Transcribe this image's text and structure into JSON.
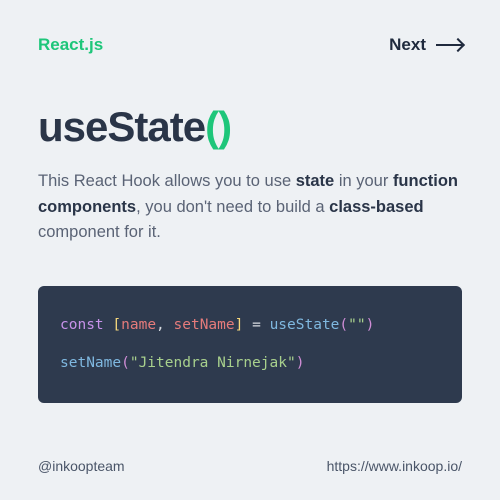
{
  "header": {
    "brand": "React.js",
    "next_label": "Next"
  },
  "title": {
    "name": "useState",
    "parens": "()"
  },
  "description": {
    "pre": "This React Hook allows you to use ",
    "b1": "state",
    "mid1": " in your ",
    "b2": "function components",
    "mid2": ", you don't need to build a ",
    "b3": "class-based",
    "post": " component for it."
  },
  "code": {
    "line1": {
      "const": "const",
      "open_bracket": " [",
      "v1": "name",
      "comma": ", ",
      "v2": "setName",
      "close_bracket": "]",
      "equals": " = ",
      "fn": "useState",
      "open_paren": "(",
      "arg": "\"\"",
      "close_paren": ")"
    },
    "line2": {
      "fn": "setName",
      "open_paren": "(",
      "arg": "\"Jitendra Nirnejak\"",
      "close_paren": ")"
    }
  },
  "footer": {
    "handle": "@inkoopteam",
    "url": "https://www.inkoop.io/"
  }
}
